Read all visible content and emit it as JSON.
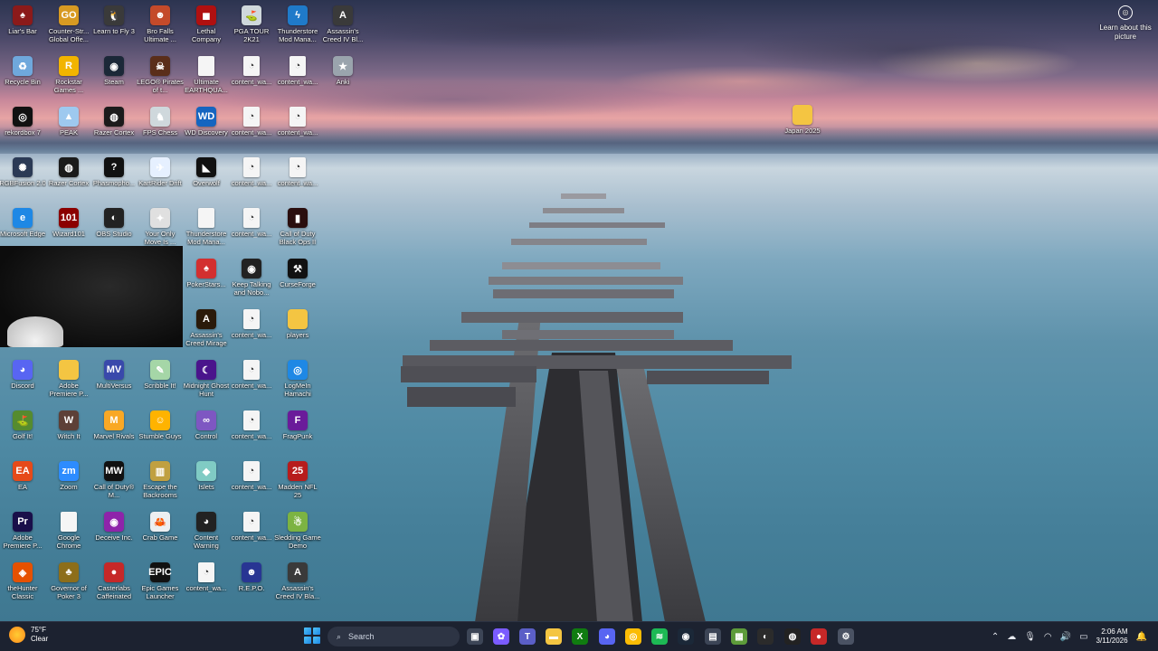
{
  "wallpaper": {
    "learn_about": "Learn about this picture",
    "learn_icon": "camera-lens-icon"
  },
  "desktop_icons": [
    {
      "label": "Liar's Bar",
      "icon": "liars-bar-icon",
      "color": "#8b1a1a",
      "glyph": "♠"
    },
    {
      "label": "Counter-Str... Global Offe...",
      "icon": "csgo-icon",
      "color": "#d89a22",
      "glyph": "GO"
    },
    {
      "label": "Learn to Fly 3",
      "icon": "learn-to-fly-icon",
      "color": "#3a3a3a",
      "glyph": "🐧"
    },
    {
      "label": "Bro Falls Ultimate ...",
      "icon": "bro-falls-icon",
      "color": "#c44a2a",
      "glyph": "☻"
    },
    {
      "label": "Lethal Company",
      "icon": "lethal-company-icon",
      "color": "#b01010",
      "glyph": "◼"
    },
    {
      "label": "PGA TOUR 2K21",
      "icon": "pga-tour-icon",
      "color": "#cfd8dc",
      "glyph": "⛳"
    },
    {
      "label": "Thunderstore Mod Mana...",
      "icon": "thunderstore-icon",
      "color": "#1f7ac9",
      "glyph": "ϟ"
    },
    {
      "label": "Assassin's Creed IV Bl...",
      "icon": "assassins-creed-icon",
      "color": "#3a3a3a",
      "glyph": "A"
    },
    {
      "label": "Recycle Bin",
      "icon": "recycle-bin-icon",
      "color": "#6fa8dc",
      "glyph": "♻"
    },
    {
      "label": "Rockstar Games ...",
      "icon": "rockstar-icon",
      "color": "#f2b400",
      "glyph": "R"
    },
    {
      "label": "Steam",
      "icon": "steam-icon",
      "color": "#1b2838",
      "glyph": "◉"
    },
    {
      "label": "LEGO® Pirates of t...",
      "icon": "lego-pirates-icon",
      "color": "#5a2e1a",
      "glyph": "☠"
    },
    {
      "label": "Ultimate EARTHQUA...",
      "icon": "document-icon",
      "color": "#f5f5f5",
      "glyph": "",
      "doc": true
    },
    {
      "label": "content_wa...",
      "icon": "content-warning-file-icon",
      "color": "#f5f5f5",
      "glyph": "◔",
      "doc": true
    },
    {
      "label": "content_wa...",
      "icon": "content-warning-file-icon",
      "color": "#f5f5f5",
      "glyph": "◔",
      "doc": true
    },
    {
      "label": "Anki",
      "icon": "anki-icon",
      "color": "#9aa4ad",
      "glyph": "★"
    },
    {
      "label": "rekordbox 7",
      "icon": "rekordbox-icon",
      "color": "#111",
      "glyph": "◎"
    },
    {
      "label": "PEAK",
      "icon": "peak-icon",
      "color": "#9ec9ef",
      "glyph": "▲"
    },
    {
      "label": "Razer Cortex",
      "icon": "razer-cortex-icon",
      "color": "#1b1b1b",
      "glyph": "◍"
    },
    {
      "label": "FPS Chess",
      "icon": "fps-chess-icon",
      "color": "#cfd8dc",
      "glyph": "♞"
    },
    {
      "label": "WD Discovery",
      "icon": "wd-discovery-icon",
      "color": "#1565c0",
      "glyph": "WD"
    },
    {
      "label": "content_wa...",
      "icon": "content-warning-file-icon",
      "color": "#f5f5f5",
      "glyph": "◔",
      "doc": true
    },
    {
      "label": "content_wa...",
      "icon": "content-warning-file-icon",
      "color": "#f5f5f5",
      "glyph": "◔",
      "doc": true
    },
    null,
    {
      "label": "RGBFusion 2.0",
      "icon": "rgb-fusion-icon",
      "color": "#2b3a55",
      "glyph": "✺"
    },
    {
      "label": "Razer Cortex",
      "icon": "razer-cortex-icon",
      "color": "#1b1b1b",
      "glyph": "◍"
    },
    {
      "label": "Phasmopho...",
      "icon": "phasmophobia-icon",
      "color": "#111",
      "glyph": "?"
    },
    {
      "label": "KartRider Drift",
      "icon": "kartrider-icon",
      "color": "#e6f0ff",
      "glyph": "✈"
    },
    {
      "label": "Overwolf",
      "icon": "overwolf-icon",
      "color": "#111",
      "glyph": "◣"
    },
    {
      "label": "content_wa...",
      "icon": "content-warning-file-icon",
      "color": "#f5f5f5",
      "glyph": "◔",
      "doc": true
    },
    {
      "label": "content_wa...",
      "icon": "content-warning-file-icon",
      "color": "#f5f5f5",
      "glyph": "◔",
      "doc": true
    },
    null,
    {
      "label": "Microsoft Edge",
      "icon": "edge-icon",
      "color": "#1e88e5",
      "glyph": "e"
    },
    {
      "label": "Wizard101",
      "icon": "wizard101-icon",
      "color": "#8b0000",
      "glyph": "101"
    },
    {
      "label": "OBS Studio",
      "icon": "obs-icon",
      "color": "#222",
      "glyph": "◐"
    },
    {
      "label": "Your Only Move Is ...",
      "icon": "your-only-move-icon",
      "color": "#e0e0e0",
      "glyph": "✦"
    },
    {
      "label": "Thunderstore Mod Mana...",
      "icon": "document-icon",
      "color": "#f5f5f5",
      "glyph": "",
      "doc": true
    },
    {
      "label": "content_wa...",
      "icon": "content-warning-file-icon",
      "color": "#f5f5f5",
      "glyph": "◔",
      "doc": true
    },
    {
      "label": "Call of Duty Black Ops II",
      "icon": "call-of-duty-icon",
      "color": "#2a0e0e",
      "glyph": "▮"
    },
    null,
    null,
    null,
    null,
    null,
    {
      "label": "PokerStars...",
      "icon": "pokerstars-icon",
      "color": "#d32f2f",
      "glyph": "♠"
    },
    {
      "label": "Keep Talking and Nobo...",
      "icon": "keep-talking-icon",
      "color": "#222",
      "glyph": "◉"
    },
    {
      "label": "CurseForge",
      "icon": "curseforge-icon",
      "color": "#111",
      "glyph": "⚒"
    },
    null,
    null,
    null,
    null,
    null,
    {
      "label": "Assassin's Creed Mirage",
      "icon": "assassins-creed-mirage-icon",
      "color": "#2a1a0a",
      "glyph": "A"
    },
    {
      "label": "content_wa...",
      "icon": "content-warning-file-icon",
      "color": "#f5f5f5",
      "glyph": "◔",
      "doc": true
    },
    {
      "label": "players",
      "icon": "folder-icon",
      "color": "#f4c542",
      "glyph": ""
    },
    null,
    {
      "label": "Discord",
      "icon": "discord-icon",
      "color": "#5865f2",
      "glyph": "◕"
    },
    {
      "label": "Adobe Premiere P...",
      "icon": "folder-icon",
      "color": "#f4c542",
      "glyph": ""
    },
    {
      "label": "MultiVersus",
      "icon": "multiversus-icon",
      "color": "#3949ab",
      "glyph": "MV"
    },
    {
      "label": "Scribble It!",
      "icon": "scribble-it-icon",
      "color": "#a5d6a7",
      "glyph": "✎"
    },
    {
      "label": "Midnight Ghost Hunt",
      "icon": "midnight-ghost-hunt-icon",
      "color": "#4a148c",
      "glyph": "☾"
    },
    {
      "label": "content_wa...",
      "icon": "content-warning-file-icon",
      "color": "#f5f5f5",
      "glyph": "◔",
      "doc": true
    },
    {
      "label": "LogMeIn Hamachi",
      "icon": "hamachi-icon",
      "color": "#1e88e5",
      "glyph": "◎"
    },
    null,
    {
      "label": "Golf It!",
      "icon": "golf-it-icon",
      "color": "#558b2f",
      "glyph": "⛳"
    },
    {
      "label": "Witch It",
      "icon": "witch-it-icon",
      "color": "#5d4037",
      "glyph": "W"
    },
    {
      "label": "Marvel Rivals",
      "icon": "marvel-rivals-icon",
      "color": "#f9a825",
      "glyph": "M"
    },
    {
      "label": "Stumble Guys",
      "icon": "stumble-guys-icon",
      "color": "#ffb300",
      "glyph": "☺"
    },
    {
      "label": "Control",
      "icon": "control-icon",
      "color": "#7e57c2",
      "glyph": "∞"
    },
    {
      "label": "content_wa...",
      "icon": "content-warning-file-icon",
      "color": "#f5f5f5",
      "glyph": "◔",
      "doc": true
    },
    {
      "label": "FragPunk",
      "icon": "fragpunk-icon",
      "color": "#6a1b9a",
      "glyph": "F"
    },
    null,
    {
      "label": "EA",
      "icon": "ea-icon",
      "color": "#e64a19",
      "glyph": "EA"
    },
    {
      "label": "Zoom",
      "icon": "zoom-icon",
      "color": "#2d8cff",
      "glyph": "zm"
    },
    {
      "label": "Call of Duty® M...",
      "icon": "call-of-duty-mw-icon",
      "color": "#111",
      "glyph": "MW"
    },
    {
      "label": "Escape the Backrooms",
      "icon": "escape-backrooms-icon",
      "color": "#c0a040",
      "glyph": "▥"
    },
    {
      "label": "Islets",
      "icon": "islets-icon",
      "color": "#80cbc4",
      "glyph": "◆"
    },
    {
      "label": "content_wa...",
      "icon": "content-warning-file-icon",
      "color": "#f5f5f5",
      "glyph": "◔",
      "doc": true
    },
    {
      "label": "Madden NFL 25",
      "icon": "madden-icon",
      "color": "#b71c1c",
      "glyph": "25"
    },
    null,
    {
      "label": "Adobe Premiere P...",
      "icon": "premiere-pro-icon",
      "color": "#1a0f4a",
      "glyph": "Pr"
    },
    {
      "label": "Google Chrome",
      "icon": "document-icon",
      "color": "#f5f5f5",
      "glyph": "",
      "doc": true
    },
    {
      "label": "Deceive Inc.",
      "icon": "deceive-inc-icon",
      "color": "#8e24aa",
      "glyph": "◉"
    },
    {
      "label": "Crab Game",
      "icon": "crab-game-icon",
      "color": "#eceff1",
      "glyph": "🦀"
    },
    {
      "label": "Content Warning",
      "icon": "content-warning-icon",
      "color": "#222",
      "glyph": "◕"
    },
    {
      "label": "content_wa...",
      "icon": "content-warning-file-icon",
      "color": "#f5f5f5",
      "glyph": "◔",
      "doc": true
    },
    {
      "label": "Sledding Game Demo",
      "icon": "sledding-game-icon",
      "color": "#7cb342",
      "glyph": "☃"
    },
    null,
    {
      "label": "theHunter Classic",
      "icon": "thehunter-icon",
      "color": "#e65100",
      "glyph": "◈"
    },
    {
      "label": "Governor of Poker 3",
      "icon": "governor-poker-icon",
      "color": "#8d6e1a",
      "glyph": "♣"
    },
    {
      "label": "Casterlabs Caffeinated",
      "icon": "casterlabs-icon",
      "color": "#c62828",
      "glyph": "●"
    },
    {
      "label": "Epic Games Launcher",
      "icon": "epic-games-icon",
      "color": "#111",
      "glyph": "EPIC"
    },
    {
      "label": "content_wa...",
      "icon": "content-warning-file-icon",
      "color": "#f5f5f5",
      "glyph": "◔",
      "doc": true
    },
    {
      "label": "R.E.P.O.",
      "icon": "repo-icon",
      "color": "#283593",
      "glyph": "☻"
    },
    {
      "label": "Assassin's Creed IV Bla...",
      "icon": "assassins-creed-icon",
      "color": "#3a3a3a",
      "glyph": "A"
    },
    null
  ],
  "floating_icon": {
    "label": "Japan 2025",
    "icon": "folder-icon",
    "color": "#f4c542"
  },
  "taskbar": {
    "weather_temp": "75°F",
    "weather_cond": "Clear",
    "search_placeholder": "Search",
    "apps": [
      {
        "name": "task-view-icon",
        "color": "#3c4556",
        "glyph": "▣"
      },
      {
        "name": "copilot-icon",
        "color": "#7b5cff",
        "glyph": "✿"
      },
      {
        "name": "teams-icon",
        "color": "#5b5fc7",
        "glyph": "T"
      },
      {
        "name": "file-explorer-icon",
        "color": "#f4c542",
        "glyph": "▬"
      },
      {
        "name": "xbox-icon",
        "color": "#107c10",
        "glyph": "X"
      },
      {
        "name": "discord-taskbar-icon",
        "color": "#5865f2",
        "glyph": "◕"
      },
      {
        "name": "chrome-icon",
        "color": "#fbbc05",
        "glyph": "◎"
      },
      {
        "name": "spotify-icon",
        "color": "#1db954",
        "glyph": "≋"
      },
      {
        "name": "steam-taskbar-icon",
        "color": "#1b2838",
        "glyph": "◉"
      },
      {
        "name": "store-icon",
        "color": "#3c4556",
        "glyph": "▤"
      },
      {
        "name": "minecraft-icon",
        "color": "#5d9b3a",
        "glyph": "▦"
      },
      {
        "name": "obs-taskbar-icon",
        "color": "#2b2b2b",
        "glyph": "◐"
      },
      {
        "name": "razer-taskbar-icon",
        "color": "#222",
        "glyph": "◍"
      },
      {
        "name": "casterlabs-taskbar-icon",
        "color": "#c62828",
        "glyph": "●"
      },
      {
        "name": "settings-icon",
        "color": "#4a5263",
        "glyph": "⚙"
      }
    ],
    "time": "2:06 AM",
    "date": "3/11/2026"
  }
}
